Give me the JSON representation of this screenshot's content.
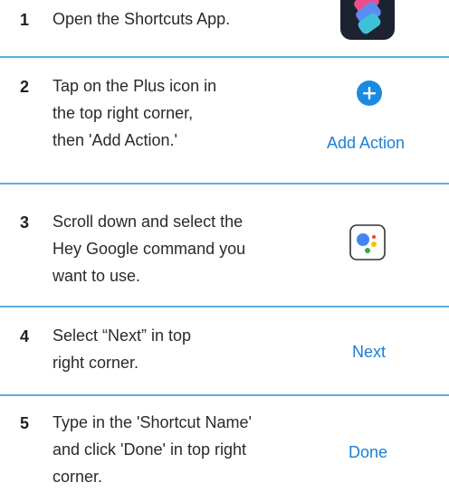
{
  "steps": [
    {
      "number": "1",
      "lines": [
        "Open the Shortcuts App."
      ],
      "icon": "shortcuts-app-icon"
    },
    {
      "number": "2",
      "lines": [
        "Tap on the Plus icon in",
        "the top right corner,",
        "then 'Add Action.'"
      ],
      "icon": "plus-icon",
      "label": "Add Action"
    },
    {
      "number": "3",
      "lines": [
        "Scroll down and select the",
        "Hey Google command you",
        "want to use."
      ],
      "icon": "google-assistant-icon"
    },
    {
      "number": "4",
      "lines": [
        "Select “Next” in top",
        "right corner."
      ],
      "label": "Next"
    },
    {
      "number": "5",
      "lines": [
        "Type in the 'Shortcut Name'",
        "and click 'Done' in top right",
        "corner."
      ],
      "label": "Done"
    }
  ],
  "colors": {
    "accent": "#1a7fd6",
    "divider": "#5aaee0",
    "plus": "#1a8be0"
  }
}
